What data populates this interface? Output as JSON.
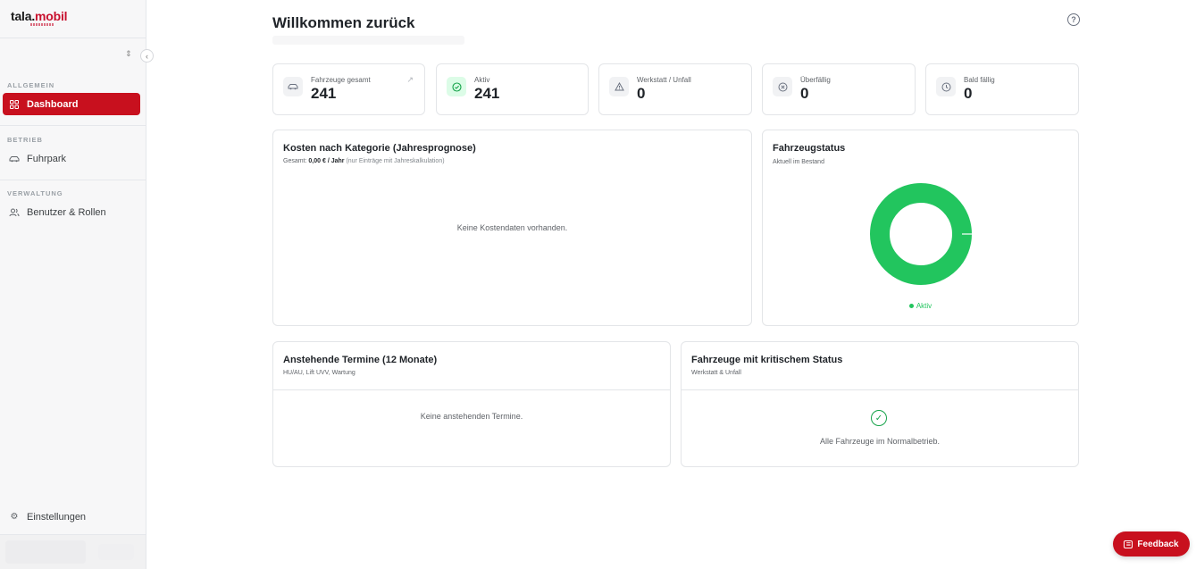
{
  "brand": {
    "name_left": "tala.",
    "name_right": "mobil",
    "accent": "#c8101e"
  },
  "sidebar": {
    "sections": [
      {
        "title": "ALLGEMEIN",
        "items": [
          {
            "label": "Dashboard",
            "icon": "grid-icon",
            "active": true
          }
        ]
      },
      {
        "title": "BETRIEB",
        "items": [
          {
            "label": "Fuhrpark",
            "icon": "car-icon",
            "active": false
          }
        ]
      },
      {
        "title": "VERWALTUNG",
        "items": [
          {
            "label": "Benutzer & Rollen",
            "icon": "users-icon",
            "active": false
          }
        ]
      }
    ],
    "settings_label": "Einstellungen"
  },
  "header": {
    "title": "Willkommen zurück"
  },
  "stats": [
    {
      "label": "Fahrzeuge gesamt",
      "value": "241",
      "icon": "car-icon"
    },
    {
      "label": "Aktiv",
      "value": "241",
      "icon": "check-circle-icon"
    },
    {
      "label": "Werkstatt / Unfall",
      "value": "0",
      "icon": "warning-icon"
    },
    {
      "label": "Überfällig",
      "value": "0",
      "icon": "x-circle-icon"
    },
    {
      "label": "Bald fällig",
      "value": "0",
      "icon": "clock-icon"
    }
  ],
  "costs": {
    "title": "Kosten nach Kategorie (Jahresprognose)",
    "sub_prefix": "Gesamt: ",
    "sub_value": "0,00 € / Jahr",
    "sub_note": " (nur Einträge mit Jahreskalkulation)",
    "empty": "Keine Kostendaten vorhanden."
  },
  "vehicle_status": {
    "title": "Fahrzeugstatus",
    "subtitle": "Aktuell im Bestand",
    "legend": "Aktiv",
    "active_share": 1.0,
    "color": "#22c55e"
  },
  "appointments": {
    "title": "Anstehende Termine (12 Monate)",
    "subtitle": "HU/AU, Lift UVV, Wartung",
    "empty": "Keine anstehenden Termine."
  },
  "critical": {
    "title": "Fahrzeuge mit kritischem Status",
    "subtitle": "Werkstatt & Unfall",
    "empty": "Alle Fahrzeuge im Normalbetrieb."
  },
  "feedback_label": "Feedback"
}
